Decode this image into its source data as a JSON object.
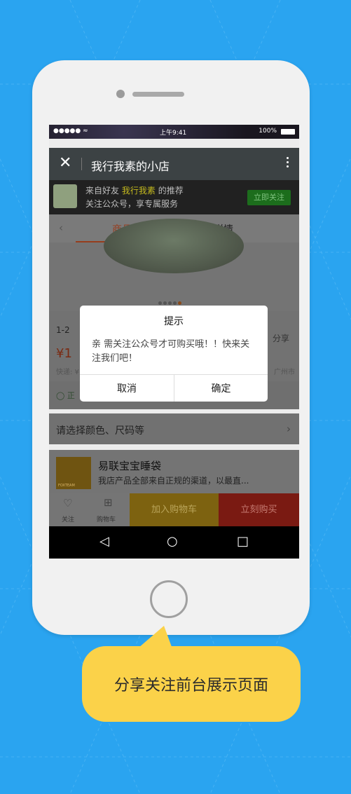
{
  "colors": {
    "background": "#2aa4f0",
    "bubble": "#fbd249",
    "accent": "#963d1d"
  },
  "status_bar": {
    "signal": "●●●●● ≈",
    "time": "上午9:41",
    "battery": "100%"
  },
  "top_bar": {
    "title": "我行我素的小店",
    "close_icon": "close-icon",
    "more_icon": "more-vertical-icon"
  },
  "follow_banner": {
    "line1_prefix": "来自好友",
    "friend_name": "我行我素",
    "line1_suffix": "的推荐",
    "line2": "关注公众号，享专属服务",
    "follow_button": "立即关注"
  },
  "tabs": [
    {
      "label": "商品",
      "active": true
    },
    {
      "label": "详情",
      "active": false
    }
  ],
  "product": {
    "code_partial": "1-2",
    "price_partial": "¥1",
    "shipping_partial": "快递: ¥",
    "location_partial": "广州市",
    "share_label": "分享",
    "verified_partial": "正"
  },
  "spec_row": {
    "label": "请选择颜色、尺码等",
    "arrow": "›"
  },
  "store": {
    "name": "易联宝宝睡袋",
    "description": "我店产品全部来自正规的渠道，以最直...",
    "logo_text": "FOXTEAM"
  },
  "bottom_bar": {
    "follow_label": "关注",
    "cart_label": "购物车",
    "add_to_cart": "加入购物车",
    "buy_now": "立刻购买"
  },
  "nav_bar": {
    "back": "◁",
    "home": "○",
    "recent": "□"
  },
  "dialog": {
    "title": "提示",
    "message": "亲 需关注公众号才可购买哦！！快来关注我们吧！",
    "cancel": "取消",
    "confirm": "确定"
  },
  "caption": "分享关注前台展示页面"
}
